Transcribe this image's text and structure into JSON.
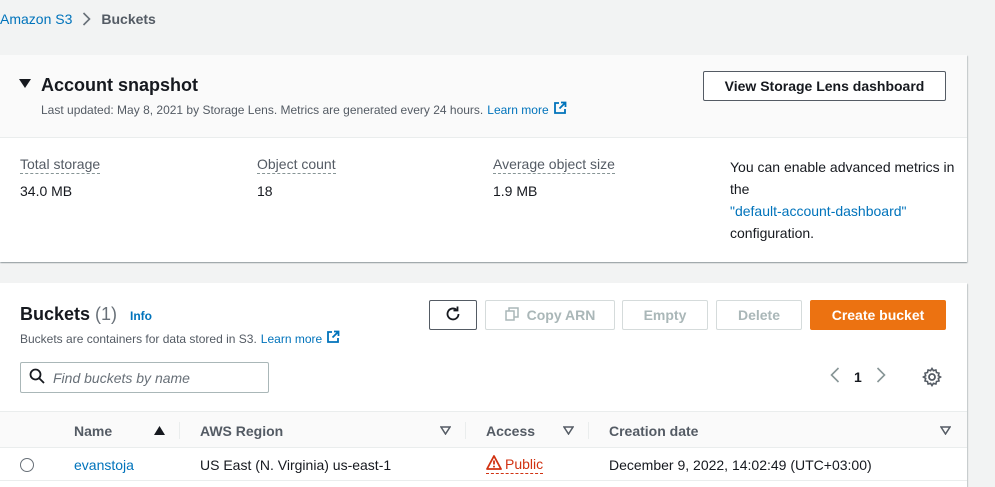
{
  "breadcrumb": {
    "root": "Amazon S3",
    "current": "Buckets"
  },
  "snapshot": {
    "title": "Account snapshot",
    "subtitle": "Last updated: May 8, 2021 by Storage Lens. Metrics are generated every 24 hours.",
    "learn_more": "Learn more",
    "view_button": "View Storage Lens dashboard",
    "metrics": [
      {
        "label": "Total storage",
        "value": "34.0 MB"
      },
      {
        "label": "Object count",
        "value": "18"
      },
      {
        "label": "Average object size",
        "value": "1.9 MB"
      }
    ],
    "advanced": {
      "prefix": "You can enable advanced metrics in the",
      "link": "\"default-account-dashboard\"",
      "suffix": "configuration."
    }
  },
  "buckets": {
    "title": "Buckets",
    "count": "(1)",
    "info": "Info",
    "description": "Buckets are containers for data stored in S3.",
    "learn_more": "Learn more",
    "actions": {
      "copy_arn": "Copy ARN",
      "empty": "Empty",
      "delete": "Delete",
      "create": "Create bucket"
    },
    "search_placeholder": "Find buckets by name",
    "page": "1",
    "columns": [
      "Name",
      "AWS Region",
      "Access",
      "Creation date"
    ],
    "rows": [
      {
        "name": "evanstoja",
        "region": "US East (N. Virginia) us-east-1",
        "access": "Public",
        "created": "December 9, 2022, 14:02:49 (UTC+03:00)"
      }
    ]
  },
  "colors": {
    "link": "#0073bb",
    "primary": "#ec7211",
    "danger": "#d13212"
  },
  "icons": [
    "chevron-right-icon",
    "caret-down-icon",
    "external-link-icon",
    "refresh-icon",
    "copy-icon",
    "search-icon",
    "chevron-left-icon",
    "gear-icon",
    "sort-ascending-icon",
    "filter-caret-icon",
    "warning-icon"
  ]
}
